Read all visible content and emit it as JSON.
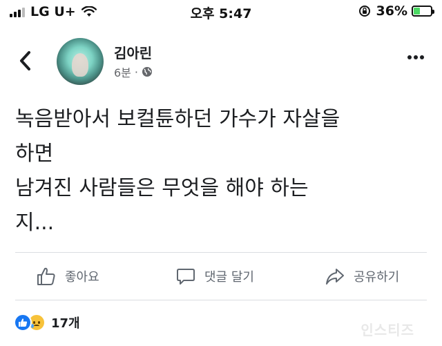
{
  "status_bar": {
    "carrier": "LG U+",
    "time": "오후 5:47",
    "battery_percent": "36%",
    "battery_level": 0.36,
    "icons": [
      "signal-icon",
      "wifi-icon",
      "rotation-lock-icon",
      "battery-charging-icon"
    ]
  },
  "post": {
    "author_name": "김아린",
    "time_ago": "6분",
    "separator": "·",
    "privacy_icon": "globe-icon",
    "text_lines": [
      "녹음받아서 보컬튠하던 가수가 자살을",
      "하면",
      "남겨진 사람들은 무엇을 해야 하는",
      "지..."
    ]
  },
  "actions": {
    "like_label": "좋아요",
    "comment_label": "댓글 달기",
    "share_label": "공유하기"
  },
  "reactions": {
    "count_label": "17개",
    "types": [
      "like",
      "sad"
    ]
  },
  "watermark": "인스티즈",
  "colors": {
    "accent_blue": "#1877f2",
    "text_primary": "#1c1e21",
    "text_secondary": "#65676b",
    "action_gray": "#606770",
    "battery_green": "#4cd964",
    "divider": "#dadde1"
  }
}
